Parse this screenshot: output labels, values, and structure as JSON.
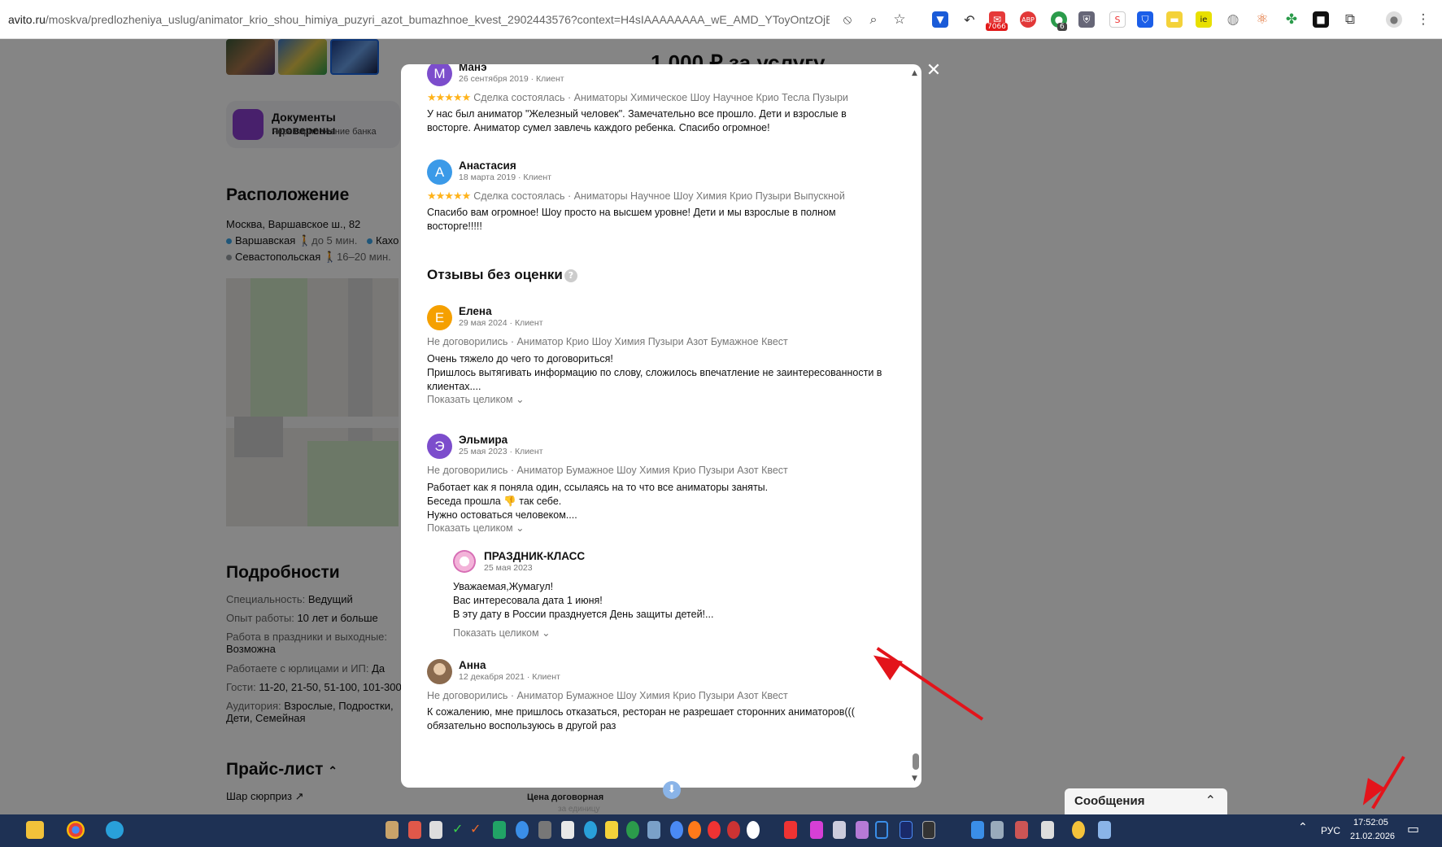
{
  "browser": {
    "url_host": "avito.ru",
    "url_path": "/moskva/predlozheniya_uslug/animator_krio_shou_himiya_puzyri_azot_bumazhnoe_kvest_2902443576?context=H4sIAAAAAAAA_wE_AMD_YToyOntzOjEzO...",
    "ext_badge_count": "7066",
    "ext_badge_small": "6"
  },
  "page": {
    "docs_title": "Документы проверены",
    "docs_subtitle": "Через приложение банка",
    "location_heading": "Расположение",
    "address": "Москва, Варшавское ш., 82",
    "metro1_name": "Варшавская",
    "metro1_time": "до 5 мин.",
    "metro2_name": "Кахо",
    "metro3_name": "Севастопольская",
    "metro3_time": "16–20 мин.",
    "details_heading": "Подробности",
    "details": [
      {
        "label": "Специальность:",
        "value": "Ведущий"
      },
      {
        "label": "Опыт работы:",
        "value": "10 лет и больше"
      },
      {
        "label": "Работа в праздники и выходные:",
        "value": "Возможна"
      },
      {
        "label": "Работаете с юрлицами и ИП:",
        "value": "Да"
      },
      {
        "label": "Гости:",
        "value": "11-20, 21-50, 51-100, 101-300"
      },
      {
        "label": "Аудитория:",
        "value": "Взрослые, Подростки, Дети, Семейная"
      }
    ],
    "price_heading": "Прайс-лист",
    "price_item": "Шар сюрприз",
    "price_label": "Цена договорная",
    "price_unit": "за единицу",
    "top_price_partial": "1 000 ₽ за услугу"
  },
  "modal": {
    "reviews": [
      {
        "avatar_letter": "М",
        "avatar_color": "#7c4dcc",
        "name": "Манэ",
        "meta": "26 сентября 2019 · Клиент",
        "deal": "Сделка состоялась · Аниматоры Химическое Шоу Научное Крио Тесла Пузыри",
        "text": "У нас был аниматор \"Железный человек\". Замечательно все прошло. Дети и взрослые в восторге. Аниматор сумел завлечь каждого ребенка. Спасибо огромное!"
      },
      {
        "avatar_letter": "А",
        "avatar_color": "#3b9ae8",
        "name": "Анастасия",
        "meta": "18 марта 2019 · Клиент",
        "deal": "Сделка состоялась · Аниматоры Научное Шоу Химия Крио Пузыри Выпускной",
        "text": "Спасибо вам огромное! Шоу просто на высшем уровне! Дети и мы взрослые в полном восторге!!!!!"
      }
    ],
    "stars": "★★★★★",
    "no_rating_heading": "Отзывы без оценки",
    "help_icon": "?",
    "no_rating": [
      {
        "avatar_letter": "Е",
        "avatar_color": "#f5a000",
        "name": "Елена",
        "meta": "29 мая 2024 · Клиент",
        "deal": "Не договорились · Аниматор Крио Шоу Химия Пузыри Азот Бумажное Квест",
        "text": "Очень тяжело до чего то договориться!\nПришлось вытягивать информацию по слову, сложилось впечатление не заинтересованности в клиентах....",
        "more": "Показать целиком ⌄"
      },
      {
        "avatar_letter": "Э",
        "avatar_color": "#7c4dcc",
        "name": "Эльмира",
        "meta": "25 мая 2023 · Клиент",
        "deal": "Не договорились · Аниматор Бумажное Шоу Химия Крио Пузыри Азот Квест",
        "text": "Работает как я поняла один, ссылаясь на то что все аниматоры заняты.\nБеседа прошла 👎 так себе.\nНужно остоваться человеком....",
        "more": "Показать целиком ⌄"
      },
      {
        "avatar_letter": "",
        "avatar_color": "#a58a6e",
        "name": "Анна",
        "meta": "12 декабря 2021 · Клиент",
        "deal": "Не договорились · Аниматор Бумажное Шоу Химия Крио Пузыри Азот Квест",
        "text": "К сожалению, мне пришлось отказаться, ресторан не разрешает сторонних аниматоров(((\nобязательно воспользуюсь в другой раз"
      }
    ],
    "reply": {
      "name": "ПРАЗДНИК-КЛАСС",
      "date": "25 мая 2023",
      "text": "Уважаемая,Жумагул!\nВас интересовала дата 1 июня!\nВ эту дату в России празднуется День защиты детей!...",
      "more": "Показать целиком ⌄"
    },
    "close_icon": "✕"
  },
  "messages": {
    "label": "Сообщения",
    "chevron": "⌃"
  },
  "taskbar": {
    "lang": "РУС",
    "time": "17:52:05",
    "date": "21.02.2026"
  },
  "colors": {
    "accent_red": "#e3141b",
    "taskbar": "#1e3154"
  }
}
